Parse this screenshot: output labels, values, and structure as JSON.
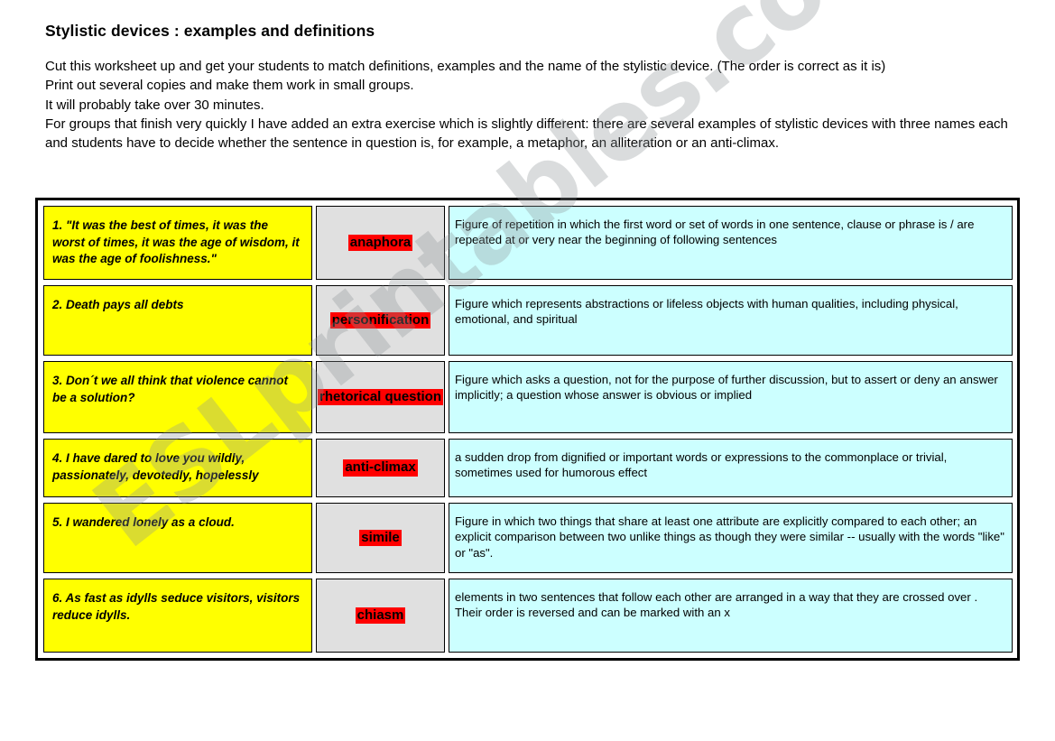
{
  "page": {
    "title": "Stylistic devices : examples and definitions",
    "intro_lines": [
      "Cut this worksheet up and get your students to match definitions, examples and the name of the stylistic device. (The order is correct as it is)",
      "Print out several copies and make them work in small groups.",
      "It will probably take over 30 minutes.",
      "For groups that finish very quickly I have added an extra exercise which is slightly different: there are several examples of stylistic devices with three names each and students have to decide whether the sentence in question is, for example, a metaphor, an alliteration or an anti-climax."
    ],
    "watermark": "ESLprintables.com"
  },
  "colors": {
    "example_bg": "#ffff00",
    "device_bg": "#e0e0e0",
    "device_highlight": "#ff0000",
    "definition_bg": "#ccffff",
    "border": "#000000",
    "watermark": "#8c9194"
  },
  "table": {
    "rows": [
      {
        "example": "1. \"It was the best of times, it was the worst of times, it was the age of wisdom, it was the age of foolishness.\"",
        "device": "anaphora",
        "definition": "Figure of repetition in which the first word or set of words in one sentence, clause or phrase is / are repeated at or very near the beginning of following sentences"
      },
      {
        "example": "2. Death pays all debts",
        "device": "personification",
        "definition": "Figure which represents abstractions or lifeless objects with human qualities, including physical, emotional, and spiritual"
      },
      {
        "example": "3. Don´t we all think that violence cannot be a solution?",
        "device": "rhetorical question",
        "definition": "Figure which asks a question, not for the purpose of further discussion, but to assert or deny an answer implicitly; a question whose answer is obvious or implied"
      },
      {
        "example": "4. I have dared to love you wildly, passionately, devotedly, hopelessly",
        "device": "anti-climax",
        "definition": "a sudden drop from dignified or important words or expressions to the commonplace or trivial, sometimes used for humorous effect"
      },
      {
        "example": "5. I wandered lonely as a cloud.",
        "device": "simile",
        "definition": "Figure in which two things that share at least one attribute are explicitly compared to each other; an explicit comparison between two unlike things as though they were similar -- usually with the words \"like\" or \"as\"."
      },
      {
        "example": "6. As fast as idylls seduce visitors, visitors reduce idylls.",
        "device": "chiasm",
        "definition": "elements in two sentences that follow each other are arranged in a way that they are crossed over . Their order is reversed and can be marked with an x"
      }
    ]
  }
}
